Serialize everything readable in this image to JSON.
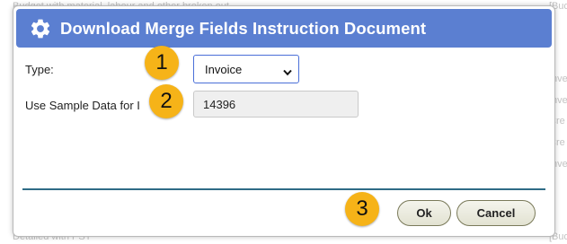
{
  "background": {
    "left_lines": [
      "Budget with material, labour and other broken out",
      "Detailed with PST"
    ],
    "right_lines": [
      "[Bud",
      "Inve",
      "Inve",
      "Cre",
      "Cre",
      "Inve",
      "[Bud"
    ]
  },
  "dialog": {
    "title": "Download Merge Fields Instruction Document",
    "title_icon": "gear-icon",
    "title_bar_color": "#5b7fd1",
    "type_label": "Type:",
    "type_value": "Invoice",
    "sample_label": "Use Sample Data for I",
    "sample_value": "14396",
    "ok_label": "Ok",
    "cancel_label": "Cancel"
  },
  "callouts": {
    "color": "#f6b318",
    "items": [
      "1",
      "2",
      "3"
    ]
  }
}
